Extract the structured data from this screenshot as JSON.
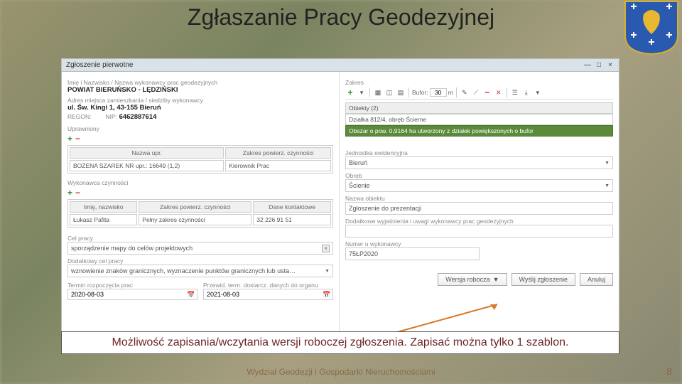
{
  "page": {
    "title": "Zgłaszanie Pracy Geodezyjnej",
    "footer": "Wydział Geodezji i Gospodarki Nieruchomościami",
    "pagenum": "8"
  },
  "callout": "Możliwość zapisania/wczytania wersji roboczej zgłoszenia. Zapisać można tylko 1 szablon.",
  "window": {
    "title": "Zgłoszenie pierwotne",
    "left": {
      "execLabel": "Imię i Nazwisko / Nazwa wykonawcy prac geodezyjnych",
      "execName": "POWIAT BIERUŃSKO - LĘDZIŃSKI",
      "addrLabel": "Adres miejsca zamieszkania / siedziby wykonawcy",
      "addr": "ul. Św. Kingi 1, 43-155 Bieruń",
      "regonLabel": "REGON:",
      "nipLabel": "NIP:",
      "nip": "6462887614",
      "uprLabel": "Uprawniony",
      "uprTable": {
        "h1": "Nazwa upr.",
        "h2": "Zakres powierz. czynności",
        "r1c1": "BOŻENA SZAREK NR upr.: 16649 (1,2)",
        "r1c2": "Kierownik Prac"
      },
      "wykLabel": "Wykonawca czynności",
      "wykTable": {
        "h1": "Imię, nazwisko",
        "h2": "Zakres powierz. czynności",
        "h3": "Dane kontaktowe",
        "r1c1": "Łukasz Pafita",
        "r1c2": "Pełny zakres czynności",
        "r1c3": "32 226 91 51"
      },
      "celLabel": "Cel pracy",
      "cel": "sporządzenie mapy do celów projektowych",
      "dodLabel": "Dodatkowy cel pracy",
      "dod": "wznowienie znaków granicznych, wyznaczenie punktów granicznych lub usta…",
      "dateStartLabel": "Termin rozpoczęcia prac",
      "dateStart": "2020-08-03",
      "dateEndLabel": "Przewid. term. dostarcz. danych do organu",
      "dateEnd": "2021-08-03"
    },
    "right": {
      "zakresLabel": "Zakres",
      "bufLabel": "Bufor:",
      "bufVal": "30",
      "bufUnit": "m",
      "objHeader": "Obiekty (2)",
      "objRow1": "Działka 812/4, obręb Ścierne",
      "objSel": "Obszar o pow. 0,9164 ha utworzony z działek powiększonych o bufor",
      "jedLabel": "Jednostka ewidencyjna",
      "jed": "Bieruń",
      "obrLabel": "Obręb",
      "obr": "Ścienie",
      "nazLabel": "Nazwa obiektu",
      "naz": "Zgłoszenie do prezentacji",
      "uwaLabel": "Dodatkowe wyjaśnienia i uwagi wykonawcy prac geodezyjnych",
      "numLabel": "Numer u wykonawcy",
      "num": "75ŁP2020",
      "btnDraft": "Wersja robocza",
      "btnSend": "Wyślij zgłoszenie",
      "btnCancel": "Anuluj"
    }
  }
}
